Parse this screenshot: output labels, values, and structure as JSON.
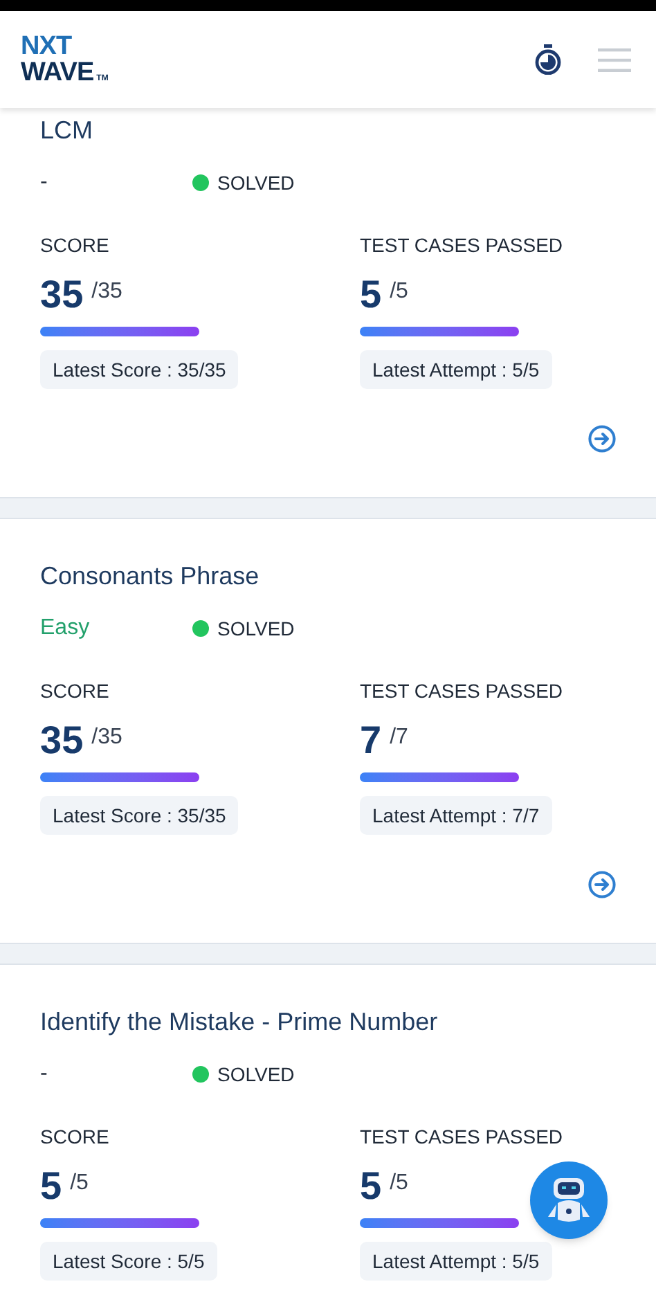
{
  "header": {
    "logo": {
      "line_1": "NXT",
      "line_2": "WAVE",
      "trademark": "TM"
    }
  },
  "problems": [
    {
      "title": "LCM",
      "difficulty": {
        "text": "-",
        "color": "#1f2937"
      },
      "status": "SOLVED",
      "score": {
        "label": "SCORE",
        "value": "35",
        "total": "/35",
        "latest": "Latest Score : 35/35"
      },
      "test_cases": {
        "label": "TEST CASES PASSED",
        "value": "5",
        "total": "/5",
        "latest": "Latest Attempt : 5/5"
      }
    },
    {
      "title": "Consonants Phrase",
      "difficulty": {
        "text": "Easy",
        "color": "#22a06b"
      },
      "status": "SOLVED",
      "score": {
        "label": "SCORE",
        "value": "35",
        "total": "/35",
        "latest": "Latest Score : 35/35"
      },
      "test_cases": {
        "label": "TEST CASES PASSED",
        "value": "7",
        "total": "/7",
        "latest": "Latest Attempt : 7/7"
      }
    },
    {
      "title": "Identify the Mistake - Prime Number",
      "difficulty": {
        "text": "-",
        "color": "#1f2937"
      },
      "status": "SOLVED",
      "score": {
        "label": "SCORE",
        "value": "5",
        "total": "/5",
        "latest": "Latest Score : 5/5"
      },
      "test_cases": {
        "label": "TEST CASES PASSED",
        "value": "5",
        "total": "/5",
        "latest": "Latest Attempt : 5/5"
      }
    }
  ]
}
